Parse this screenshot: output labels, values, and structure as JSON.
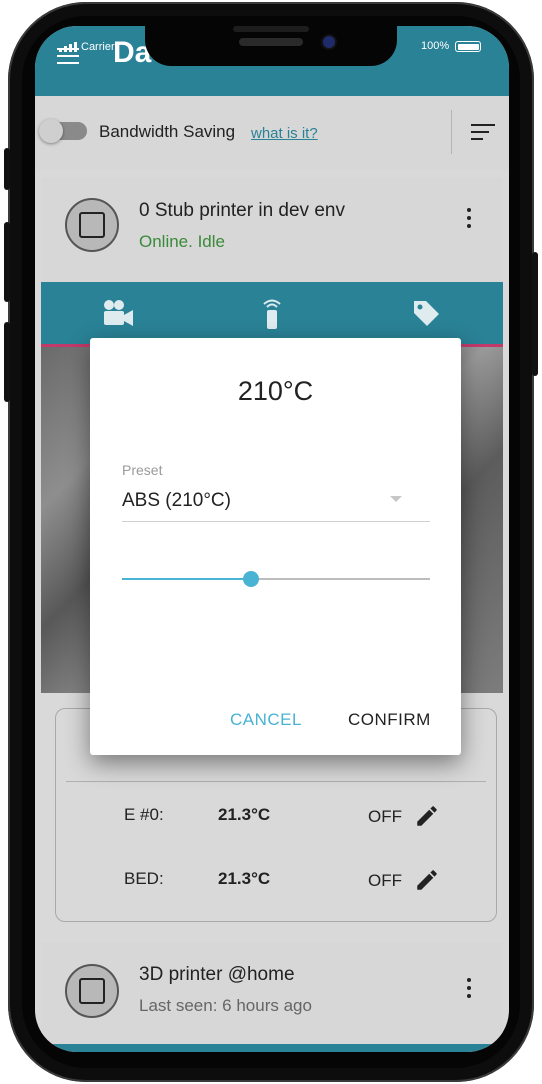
{
  "status_bar": {
    "carrier": "Carrier",
    "battery": "100%"
  },
  "app": {
    "title": "Da"
  },
  "toolbar": {
    "bandwidth_label": "Bandwidth Saving",
    "bandwidth_link": "what is it?"
  },
  "printers": [
    {
      "name": "0 Stub printer in dev env",
      "status": "Online. Idle"
    },
    {
      "name": "3D printer @home",
      "status": "Last seen: 6 hours ago"
    }
  ],
  "temperatures": [
    {
      "label": "E #0:",
      "value": "21.3°C",
      "target": "OFF"
    },
    {
      "label": "BED:",
      "value": "21.3°C",
      "target": "OFF"
    }
  ],
  "dialog": {
    "title": "210°C",
    "preset_label": "Preset",
    "preset_value": "ABS (210°C)",
    "slider_fraction": 0.42,
    "cancel": "CANCEL",
    "confirm": "CONFIRM"
  },
  "colors": {
    "primary": "#2a8296",
    "accent": "#49b3d3",
    "online": "#3a8a3a"
  },
  "icons": [
    "menu-icon",
    "sort-icon",
    "more-vert-icon",
    "video-camera-icon",
    "remote-icon",
    "tag-icon",
    "pencil-icon",
    "dropdown-caret-icon"
  ]
}
